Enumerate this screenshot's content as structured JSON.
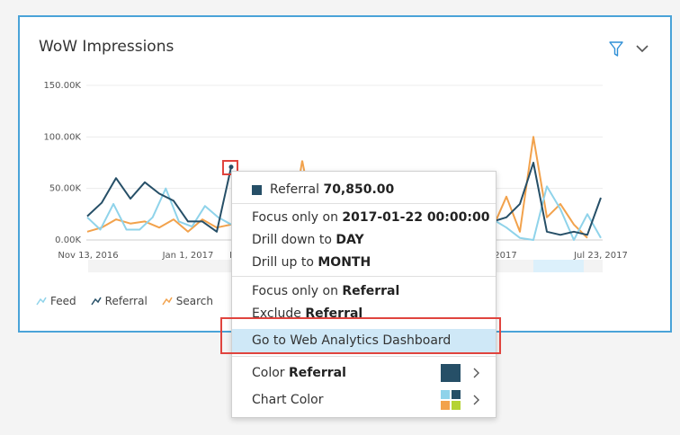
{
  "card": {
    "title": "WoW Impressions",
    "filter_icon": "filter-icon",
    "menu_icon": "chevron-down-icon"
  },
  "chart_data": {
    "type": "line",
    "title": "",
    "ylabel": "",
    "xlabel": "",
    "y_ticks": [
      "150.00K",
      "100.00K",
      "50.00K",
      "0.00K"
    ],
    "x_ticks": [
      "Nov 13, 2016",
      "Jan 1, 2017",
      "F",
      "2017",
      "Jul 23, 2017"
    ],
    "ylim": [
      0,
      150000
    ],
    "grid": true,
    "legend_position": "bottom-left",
    "series": [
      {
        "name": "Feed",
        "color": "#8fd3ea",
        "values": [
          22000,
          10000,
          35000,
          10000,
          10000,
          22000,
          50000,
          18000,
          13000,
          33000,
          22000,
          15000
        ]
      },
      {
        "name": "Referral",
        "color": "#264f67",
        "values": [
          23000,
          36000,
          60000,
          40000,
          56000,
          45000,
          38000,
          18000,
          18000,
          8000,
          70850
        ]
      },
      {
        "name": "Search",
        "color": "#f2a24c",
        "values": [
          8000,
          12000,
          20000,
          16000,
          18000,
          12000,
          20000,
          8000,
          20000,
          12000,
          15000
        ]
      }
    ],
    "right_series": [
      {
        "name": "Feed",
        "values": [
          20000,
          12000,
          2000,
          0,
          52000,
          30000,
          0,
          25000,
          2000
        ]
      },
      {
        "name": "Referral",
        "values": [
          18000,
          22000,
          35000,
          75000,
          8000,
          5000,
          8000,
          5000,
          41000
        ]
      },
      {
        "name": "Search",
        "values": [
          12000,
          42000,
          8000,
          100000,
          22000,
          35000,
          15000,
          2000
        ]
      }
    ],
    "peek_orange": 77000
  },
  "legend": [
    {
      "name": "Feed",
      "color": "#8fd3ea"
    },
    {
      "name": "Referral",
      "color": "#264f67"
    },
    {
      "name": "Search",
      "color": "#f2a24c"
    }
  ],
  "menu": {
    "header_label": "Referral",
    "header_value": "70,850.00",
    "focus_date_prefix": "Focus only on",
    "focus_date_value": "2017-01-22 00:00:00",
    "drill_down_prefix": "Drill down to",
    "drill_down_value": "DAY",
    "drill_up_prefix": "Drill up to",
    "drill_up_value": "MONTH",
    "focus_series_prefix": "Focus only on",
    "focus_series_value": "Referral",
    "exclude_prefix": "Exclude",
    "exclude_value": "Referral",
    "goto_label": "Go to Web Analytics Dashboard",
    "color_prefix": "Color",
    "color_value": "Referral",
    "chart_color_label": "Chart Color",
    "referral_color": "#264f67",
    "chart_colors": [
      "#8fd3ea",
      "#264f67",
      "#f2a24c",
      "#b5d334"
    ]
  }
}
